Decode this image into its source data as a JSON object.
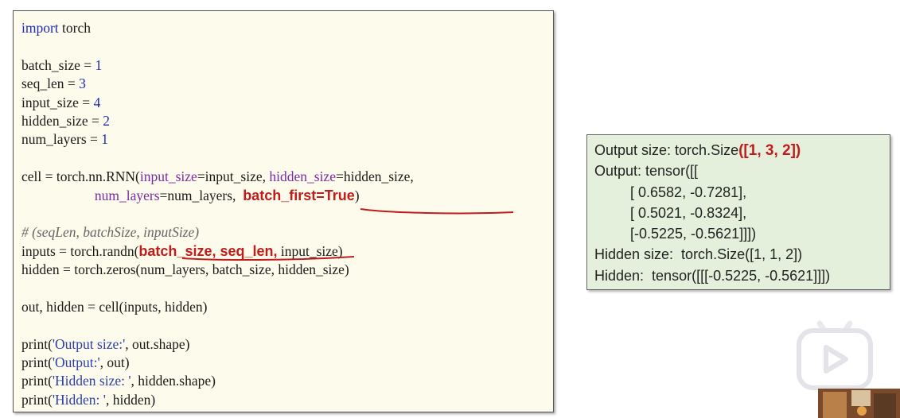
{
  "code": {
    "import_kw": "import",
    "import_mod": " torch",
    "batch_size_var": "batch_size = ",
    "batch_size_val": "1",
    "seq_len_var": "seq_len = ",
    "seq_len_val": "3",
    "input_size_var": "input_size = ",
    "input_size_val": "4",
    "hidden_size_var": "hidden_size = ",
    "hidden_size_val": "2",
    "num_layers_var": "num_layers = ",
    "num_layers_val": "1",
    "cell_prefix": "cell = torch.nn.RNN(",
    "cell_param1": "input_size",
    "cell_val1": "=input_size, ",
    "cell_param2": "hidden_size",
    "cell_val2": "=hidden_size,",
    "cell2_indent": "                     ",
    "cell2_param": "num_layers",
    "cell2_val": "=num_layers,  ",
    "cell2_highlight": "batch_first=True",
    "cell2_close": ")",
    "comment": "# (seqLen, batchSize, inputSize)",
    "inputs_prefix": "inputs = torch.randn(",
    "inputs_highlight": "batch_size, seq_len,",
    "inputs_rest": " input_size)",
    "hidden_line": "hidden = torch.zeros(num_layers, batch_size, hidden_size)",
    "out_line": "out, hidden = cell(inputs, hidden)",
    "print_kw": "print",
    "print1_str": "'Output size:'",
    "print1_rest": ", out.shape)",
    "print2_str": "'Output:'",
    "print2_rest": ", out)",
    "print3_str": "'Hidden size: '",
    "print3_rest": ", hidden.shape)",
    "print4_str": "'Hidden: '",
    "print4_rest": ", hidden)"
  },
  "output": {
    "line1_prefix": "Output size: torch.Size",
    "line1_highlight": "([1, 3, 2])",
    "line2": "Output: tensor([[",
    "line3": "         [ 0.6582, -0.7281],",
    "line4": "         [ 0.5021, -0.8324],",
    "line5": "         [-0.5225, -0.5621]]])",
    "line6": "Hidden size:  torch.Size([1, 1, 2])",
    "line7": "Hidden:  tensor([[[-0.5225, -0.5621]]])"
  },
  "colors": {
    "highlight": "#c01c1c",
    "keyword": "#1f2bb5",
    "code_bg": "#fdfbec",
    "output_bg": "#e5f0dc"
  },
  "icons": [
    "play-icon",
    "tv-logo-icon"
  ]
}
